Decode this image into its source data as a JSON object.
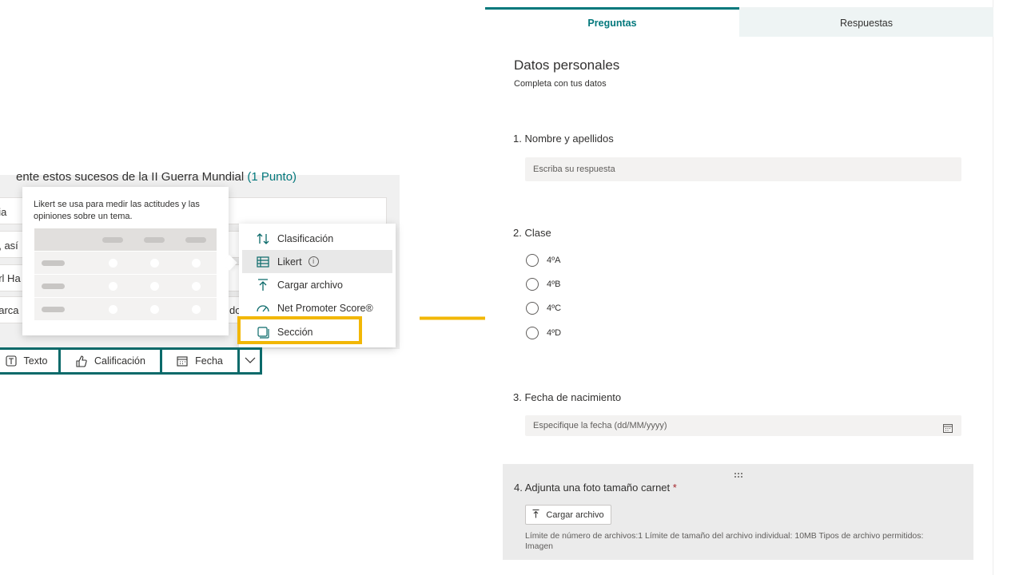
{
  "left": {
    "question_title": "ente estos sucesos de la II Guerra Mundial",
    "question_points": "(1 Punto)",
    "option_fragments": [
      "nia",
      "a, así",
      "arl Ha",
      "barca"
    ],
    "row_tail": "do",
    "tooltip_text": "Likert se usa para medir las actitudes y las opiniones sobre un tema.",
    "menu": {
      "items": [
        {
          "label": "Clasificación",
          "icon": "ranking-icon"
        },
        {
          "label": "Likert",
          "icon": "likert-icon"
        },
        {
          "label": "Cargar archivo",
          "icon": "upload-icon"
        },
        {
          "label": "Net Promoter Score®",
          "icon": "gauge-icon"
        },
        {
          "label": "Sección",
          "icon": "section-icon"
        }
      ]
    },
    "question_types": [
      {
        "label": "Texto",
        "icon": "text-icon"
      },
      {
        "label": "Calificación",
        "icon": "thumbs-up-icon"
      },
      {
        "label": "Fecha",
        "icon": "calendar-icon"
      }
    ],
    "highlight_color": "#f2b705",
    "accent_color": "#0b6a6a"
  },
  "right": {
    "tabs": [
      {
        "label": "Preguntas",
        "active": true
      },
      {
        "label": "Respuestas",
        "active": false
      }
    ],
    "section_title": "Datos personales",
    "section_subtitle": "Completa con tus datos",
    "q1": {
      "label": "1. Nombre y apellidos",
      "placeholder": "Escriba su respuesta"
    },
    "q2": {
      "label": "2. Clase",
      "options": [
        "4ºA",
        "4ºB",
        "4ºC",
        "4ºD"
      ]
    },
    "q3": {
      "label": "3. Fecha de nacimiento",
      "placeholder": "Especifique la fecha (dd/MM/yyyy)"
    },
    "q4": {
      "label": "4. Adjunta una foto tamaño carnet",
      "required_mark": "*",
      "upload_label": "Cargar archivo",
      "limits": "Límite de número de archivos:1   Límite de tamaño del archivo individual: 10MB   Tipos de archivo permitidos: Imagen"
    }
  }
}
